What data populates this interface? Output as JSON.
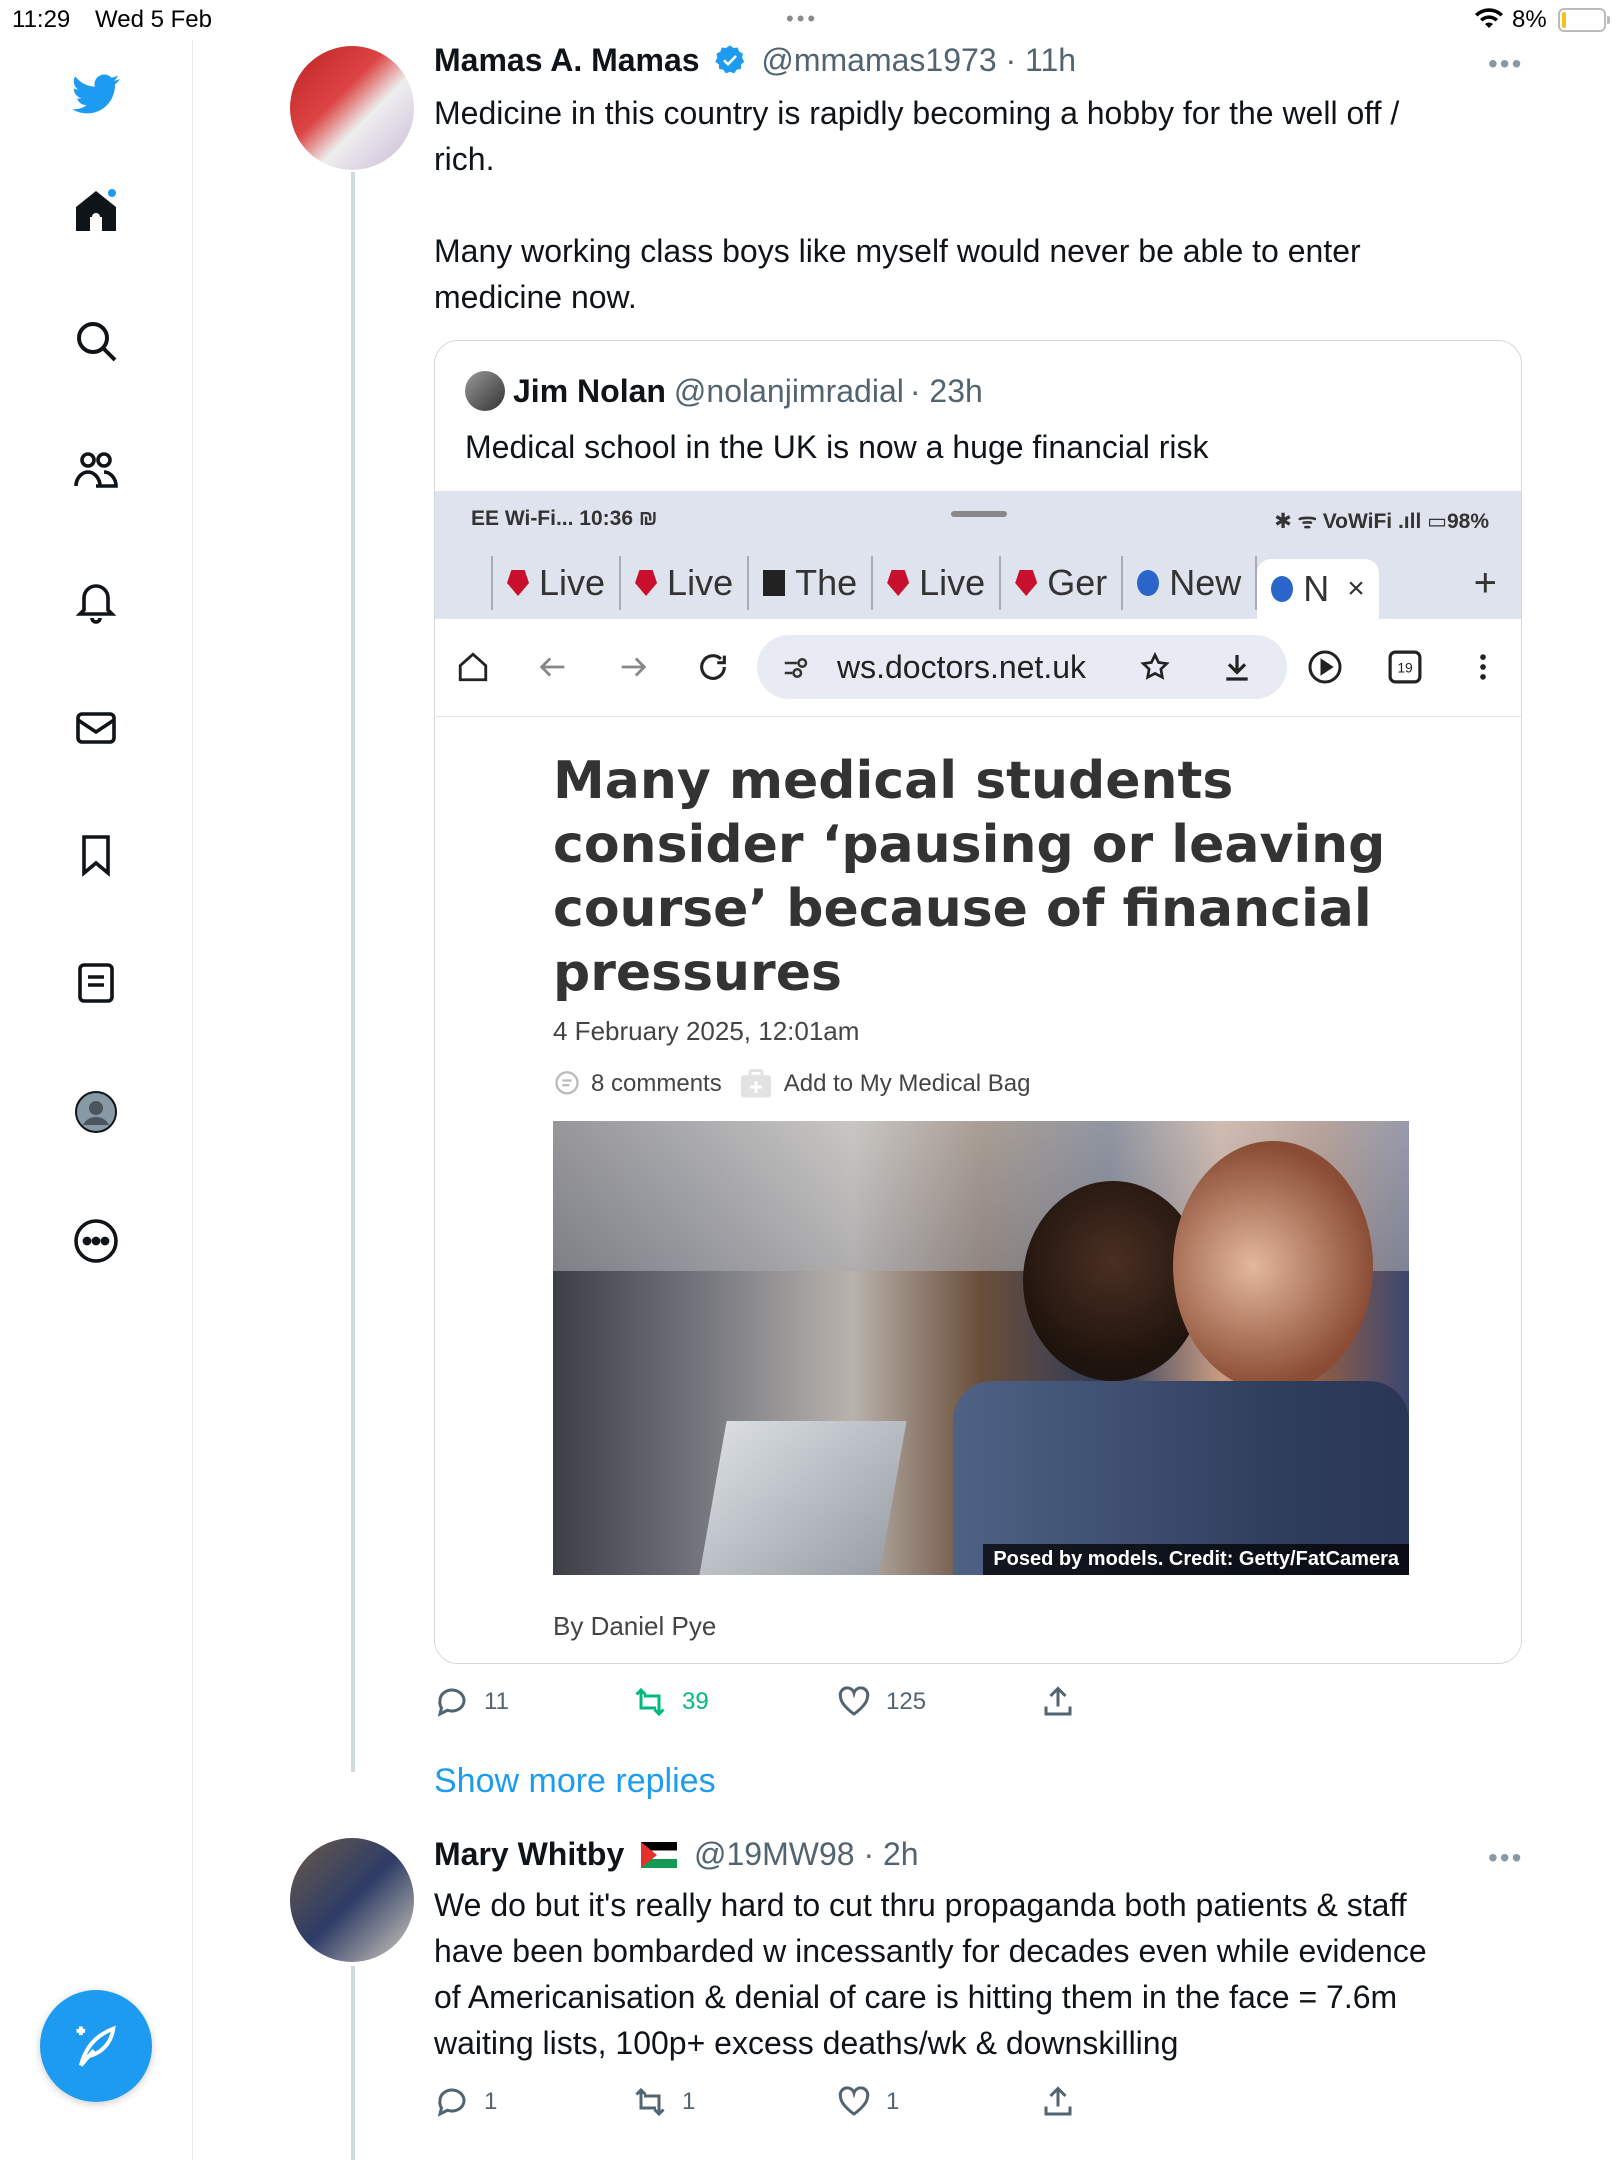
{
  "status_bar": {
    "time": "11:29",
    "date": "Wed 5 Feb",
    "dots": "•••",
    "battery": "8%"
  },
  "sidebar": {
    "items": [
      {
        "name": "twitter-logo",
        "icon": "twitter-bird-icon"
      },
      {
        "name": "home",
        "icon": "home-icon"
      },
      {
        "name": "explore",
        "icon": "search-icon"
      },
      {
        "name": "communities",
        "icon": "people-icon"
      },
      {
        "name": "notifications",
        "icon": "bell-icon"
      },
      {
        "name": "messages",
        "icon": "mail-icon"
      },
      {
        "name": "bookmarks",
        "icon": "bookmark-icon"
      },
      {
        "name": "lists",
        "icon": "list-icon"
      },
      {
        "name": "profile",
        "icon": "profile-icon"
      },
      {
        "name": "more",
        "icon": "more-circle-icon"
      }
    ],
    "compose_icon": "compose-feather-icon",
    "accent_color": "#1d9bf0"
  },
  "tweet1": {
    "name": "Mamas A. Mamas",
    "handle": "@mmamas1973",
    "time": "· 11h",
    "more": "•••",
    "text": "Medicine in this country is rapidly becoming a hobby for the well off /\nrich.\n\nMany working class boys like myself would never be able to enter\nmedicine now.",
    "quote": {
      "name": "Jim Nolan",
      "handle": "@nolanjimradial",
      "time": "· 23h",
      "text": "Medical school in the UK is now a huge financial risk",
      "screenshot": {
        "status_left": "EE Wi-Fi... 10:36 ₪",
        "status_right": "✱ ᯤ VoWiFi .ıll ▭98%",
        "tabs": [
          "Live",
          "Live",
          "The",
          "Live",
          "Ger",
          "New",
          "N"
        ],
        "tab_close": "×",
        "tab_plus": "+",
        "url": "ws.doctors.net.uk",
        "tab_count": "19",
        "article_title": "Many medical students consider ‘pausing or leaving course’ because of financial pressures",
        "article_date": "4 February 2025, 12:01am",
        "comments": "8 comments",
        "add_bag": "Add to My Medical Bag",
        "photo_credit": "Posed by models. Credit: Getty/FatCamera",
        "byline": "By Daniel Pye"
      }
    },
    "actions": {
      "replies": "11",
      "retweets": "39",
      "likes": "125"
    }
  },
  "show_more": "Show more replies",
  "tweet2": {
    "name": "Mary Whitby",
    "flag": "🇵🇸",
    "handle": "@19MW98",
    "time": "· 2h",
    "more": "•••",
    "text": "We do but it's really hard to cut thru propaganda both patients & staff\nhave been bombarded w incessantly for decades even while evidence\nof Americanisation & denial of care is hitting them in the face = 7.6m\nwaiting lists, 100p+ excess deaths/wk & downskilling",
    "actions": {
      "replies": "1",
      "retweets": "1",
      "likes": "1"
    }
  }
}
